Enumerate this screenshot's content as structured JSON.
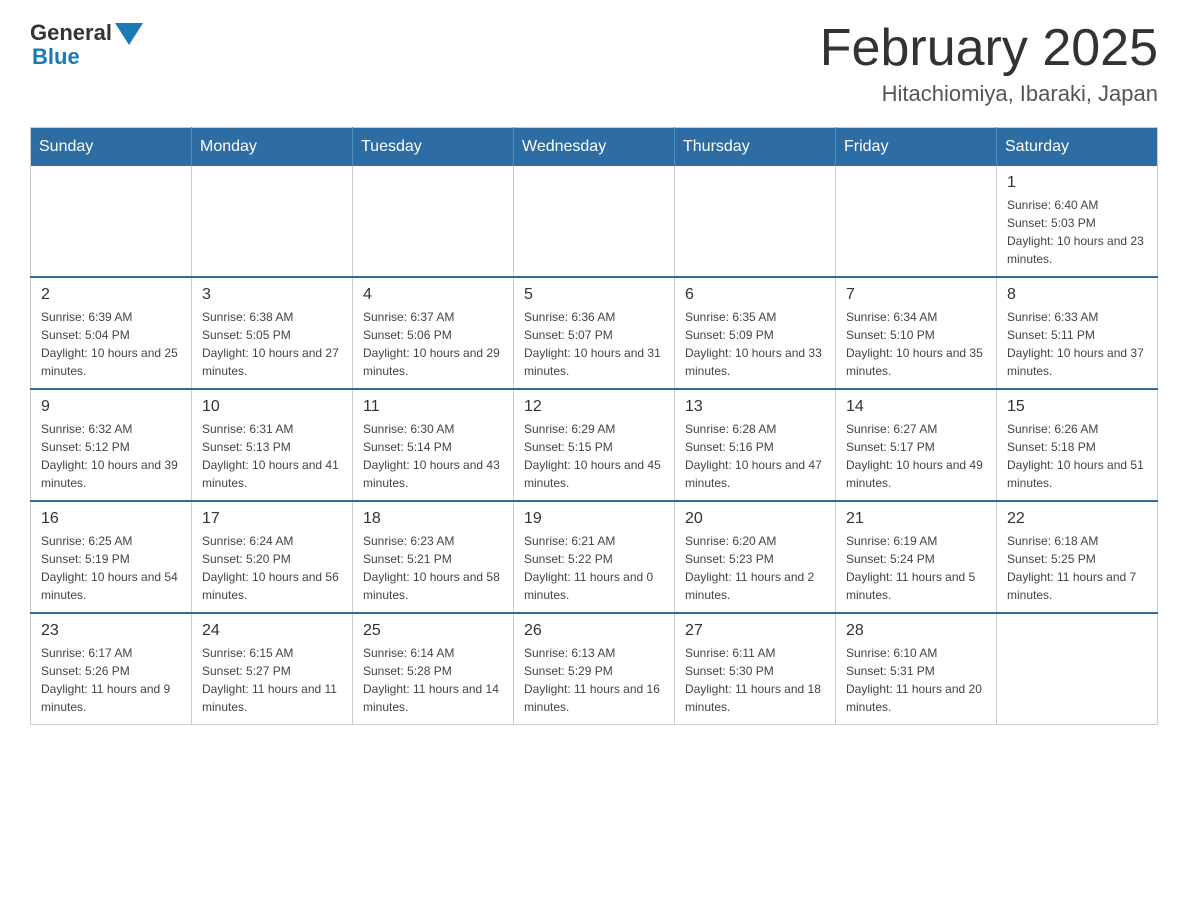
{
  "header": {
    "logo_general": "General",
    "logo_blue": "Blue",
    "month_title": "February 2025",
    "location": "Hitachiomiya, Ibaraki, Japan"
  },
  "weekdays": [
    "Sunday",
    "Monday",
    "Tuesday",
    "Wednesday",
    "Thursday",
    "Friday",
    "Saturday"
  ],
  "weeks": [
    [
      {
        "day": "",
        "sunrise": "",
        "sunset": "",
        "daylight": ""
      },
      {
        "day": "",
        "sunrise": "",
        "sunset": "",
        "daylight": ""
      },
      {
        "day": "",
        "sunrise": "",
        "sunset": "",
        "daylight": ""
      },
      {
        "day": "",
        "sunrise": "",
        "sunset": "",
        "daylight": ""
      },
      {
        "day": "",
        "sunrise": "",
        "sunset": "",
        "daylight": ""
      },
      {
        "day": "",
        "sunrise": "",
        "sunset": "",
        "daylight": ""
      },
      {
        "day": "1",
        "sunrise": "Sunrise: 6:40 AM",
        "sunset": "Sunset: 5:03 PM",
        "daylight": "Daylight: 10 hours and 23 minutes."
      }
    ],
    [
      {
        "day": "2",
        "sunrise": "Sunrise: 6:39 AM",
        "sunset": "Sunset: 5:04 PM",
        "daylight": "Daylight: 10 hours and 25 minutes."
      },
      {
        "day": "3",
        "sunrise": "Sunrise: 6:38 AM",
        "sunset": "Sunset: 5:05 PM",
        "daylight": "Daylight: 10 hours and 27 minutes."
      },
      {
        "day": "4",
        "sunrise": "Sunrise: 6:37 AM",
        "sunset": "Sunset: 5:06 PM",
        "daylight": "Daylight: 10 hours and 29 minutes."
      },
      {
        "day": "5",
        "sunrise": "Sunrise: 6:36 AM",
        "sunset": "Sunset: 5:07 PM",
        "daylight": "Daylight: 10 hours and 31 minutes."
      },
      {
        "day": "6",
        "sunrise": "Sunrise: 6:35 AM",
        "sunset": "Sunset: 5:09 PM",
        "daylight": "Daylight: 10 hours and 33 minutes."
      },
      {
        "day": "7",
        "sunrise": "Sunrise: 6:34 AM",
        "sunset": "Sunset: 5:10 PM",
        "daylight": "Daylight: 10 hours and 35 minutes."
      },
      {
        "day": "8",
        "sunrise": "Sunrise: 6:33 AM",
        "sunset": "Sunset: 5:11 PM",
        "daylight": "Daylight: 10 hours and 37 minutes."
      }
    ],
    [
      {
        "day": "9",
        "sunrise": "Sunrise: 6:32 AM",
        "sunset": "Sunset: 5:12 PM",
        "daylight": "Daylight: 10 hours and 39 minutes."
      },
      {
        "day": "10",
        "sunrise": "Sunrise: 6:31 AM",
        "sunset": "Sunset: 5:13 PM",
        "daylight": "Daylight: 10 hours and 41 minutes."
      },
      {
        "day": "11",
        "sunrise": "Sunrise: 6:30 AM",
        "sunset": "Sunset: 5:14 PM",
        "daylight": "Daylight: 10 hours and 43 minutes."
      },
      {
        "day": "12",
        "sunrise": "Sunrise: 6:29 AM",
        "sunset": "Sunset: 5:15 PM",
        "daylight": "Daylight: 10 hours and 45 minutes."
      },
      {
        "day": "13",
        "sunrise": "Sunrise: 6:28 AM",
        "sunset": "Sunset: 5:16 PM",
        "daylight": "Daylight: 10 hours and 47 minutes."
      },
      {
        "day": "14",
        "sunrise": "Sunrise: 6:27 AM",
        "sunset": "Sunset: 5:17 PM",
        "daylight": "Daylight: 10 hours and 49 minutes."
      },
      {
        "day": "15",
        "sunrise": "Sunrise: 6:26 AM",
        "sunset": "Sunset: 5:18 PM",
        "daylight": "Daylight: 10 hours and 51 minutes."
      }
    ],
    [
      {
        "day": "16",
        "sunrise": "Sunrise: 6:25 AM",
        "sunset": "Sunset: 5:19 PM",
        "daylight": "Daylight: 10 hours and 54 minutes."
      },
      {
        "day": "17",
        "sunrise": "Sunrise: 6:24 AM",
        "sunset": "Sunset: 5:20 PM",
        "daylight": "Daylight: 10 hours and 56 minutes."
      },
      {
        "day": "18",
        "sunrise": "Sunrise: 6:23 AM",
        "sunset": "Sunset: 5:21 PM",
        "daylight": "Daylight: 10 hours and 58 minutes."
      },
      {
        "day": "19",
        "sunrise": "Sunrise: 6:21 AM",
        "sunset": "Sunset: 5:22 PM",
        "daylight": "Daylight: 11 hours and 0 minutes."
      },
      {
        "day": "20",
        "sunrise": "Sunrise: 6:20 AM",
        "sunset": "Sunset: 5:23 PM",
        "daylight": "Daylight: 11 hours and 2 minutes."
      },
      {
        "day": "21",
        "sunrise": "Sunrise: 6:19 AM",
        "sunset": "Sunset: 5:24 PM",
        "daylight": "Daylight: 11 hours and 5 minutes."
      },
      {
        "day": "22",
        "sunrise": "Sunrise: 6:18 AM",
        "sunset": "Sunset: 5:25 PM",
        "daylight": "Daylight: 11 hours and 7 minutes."
      }
    ],
    [
      {
        "day": "23",
        "sunrise": "Sunrise: 6:17 AM",
        "sunset": "Sunset: 5:26 PM",
        "daylight": "Daylight: 11 hours and 9 minutes."
      },
      {
        "day": "24",
        "sunrise": "Sunrise: 6:15 AM",
        "sunset": "Sunset: 5:27 PM",
        "daylight": "Daylight: 11 hours and 11 minutes."
      },
      {
        "day": "25",
        "sunrise": "Sunrise: 6:14 AM",
        "sunset": "Sunset: 5:28 PM",
        "daylight": "Daylight: 11 hours and 14 minutes."
      },
      {
        "day": "26",
        "sunrise": "Sunrise: 6:13 AM",
        "sunset": "Sunset: 5:29 PM",
        "daylight": "Daylight: 11 hours and 16 minutes."
      },
      {
        "day": "27",
        "sunrise": "Sunrise: 6:11 AM",
        "sunset": "Sunset: 5:30 PM",
        "daylight": "Daylight: 11 hours and 18 minutes."
      },
      {
        "day": "28",
        "sunrise": "Sunrise: 6:10 AM",
        "sunset": "Sunset: 5:31 PM",
        "daylight": "Daylight: 11 hours and 20 minutes."
      },
      {
        "day": "",
        "sunrise": "",
        "sunset": "",
        "daylight": ""
      }
    ]
  ]
}
